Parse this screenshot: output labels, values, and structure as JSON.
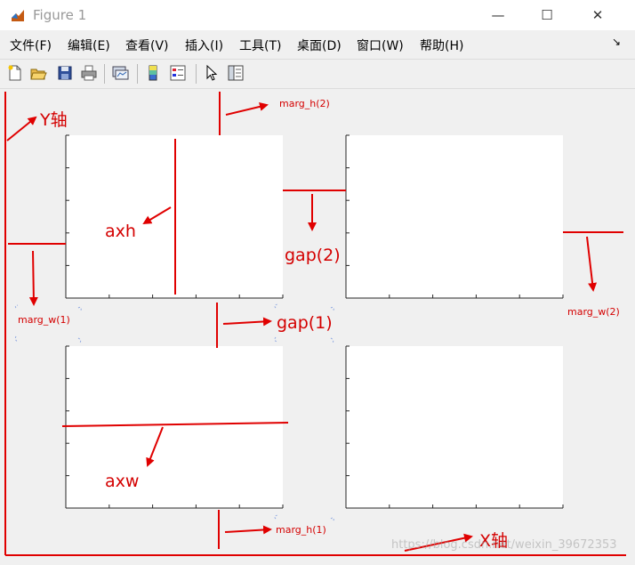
{
  "window": {
    "title": "Figure 1"
  },
  "window_controls": {
    "minimize": "—",
    "maximize": "☐",
    "close": "✕"
  },
  "menu": {
    "items": [
      "文件(F)",
      "编辑(E)",
      "查看(V)",
      "插入(I)",
      "工具(T)",
      "桌面(D)",
      "窗口(W)",
      "帮助(H)"
    ],
    "overflow": "↘"
  },
  "toolbar": {
    "icons": [
      "new-figure-icon",
      "open-file-icon",
      "save-icon",
      "print-icon",
      "link-plot-icon",
      "colorbar-icon",
      "legend-icon",
      "pointer-icon",
      "property-editor-icon"
    ]
  },
  "annotations": {
    "y_axis": "Y轴",
    "x_axis": "X轴",
    "marg_h2": "marg_h(2)",
    "marg_h1": "marg_h(1)",
    "marg_w1": "marg_w(1)",
    "marg_w2": "marg_w(2)",
    "gap2": "gap(2)",
    "gap1": "gap(1)",
    "axh": "axh",
    "axw": "axw"
  },
  "watermark": "https://blog.csdn.net/weixin_39672353",
  "colors": {
    "annotation": "#e00000",
    "background": "#f0f0f0",
    "axes": "#ffffff"
  }
}
